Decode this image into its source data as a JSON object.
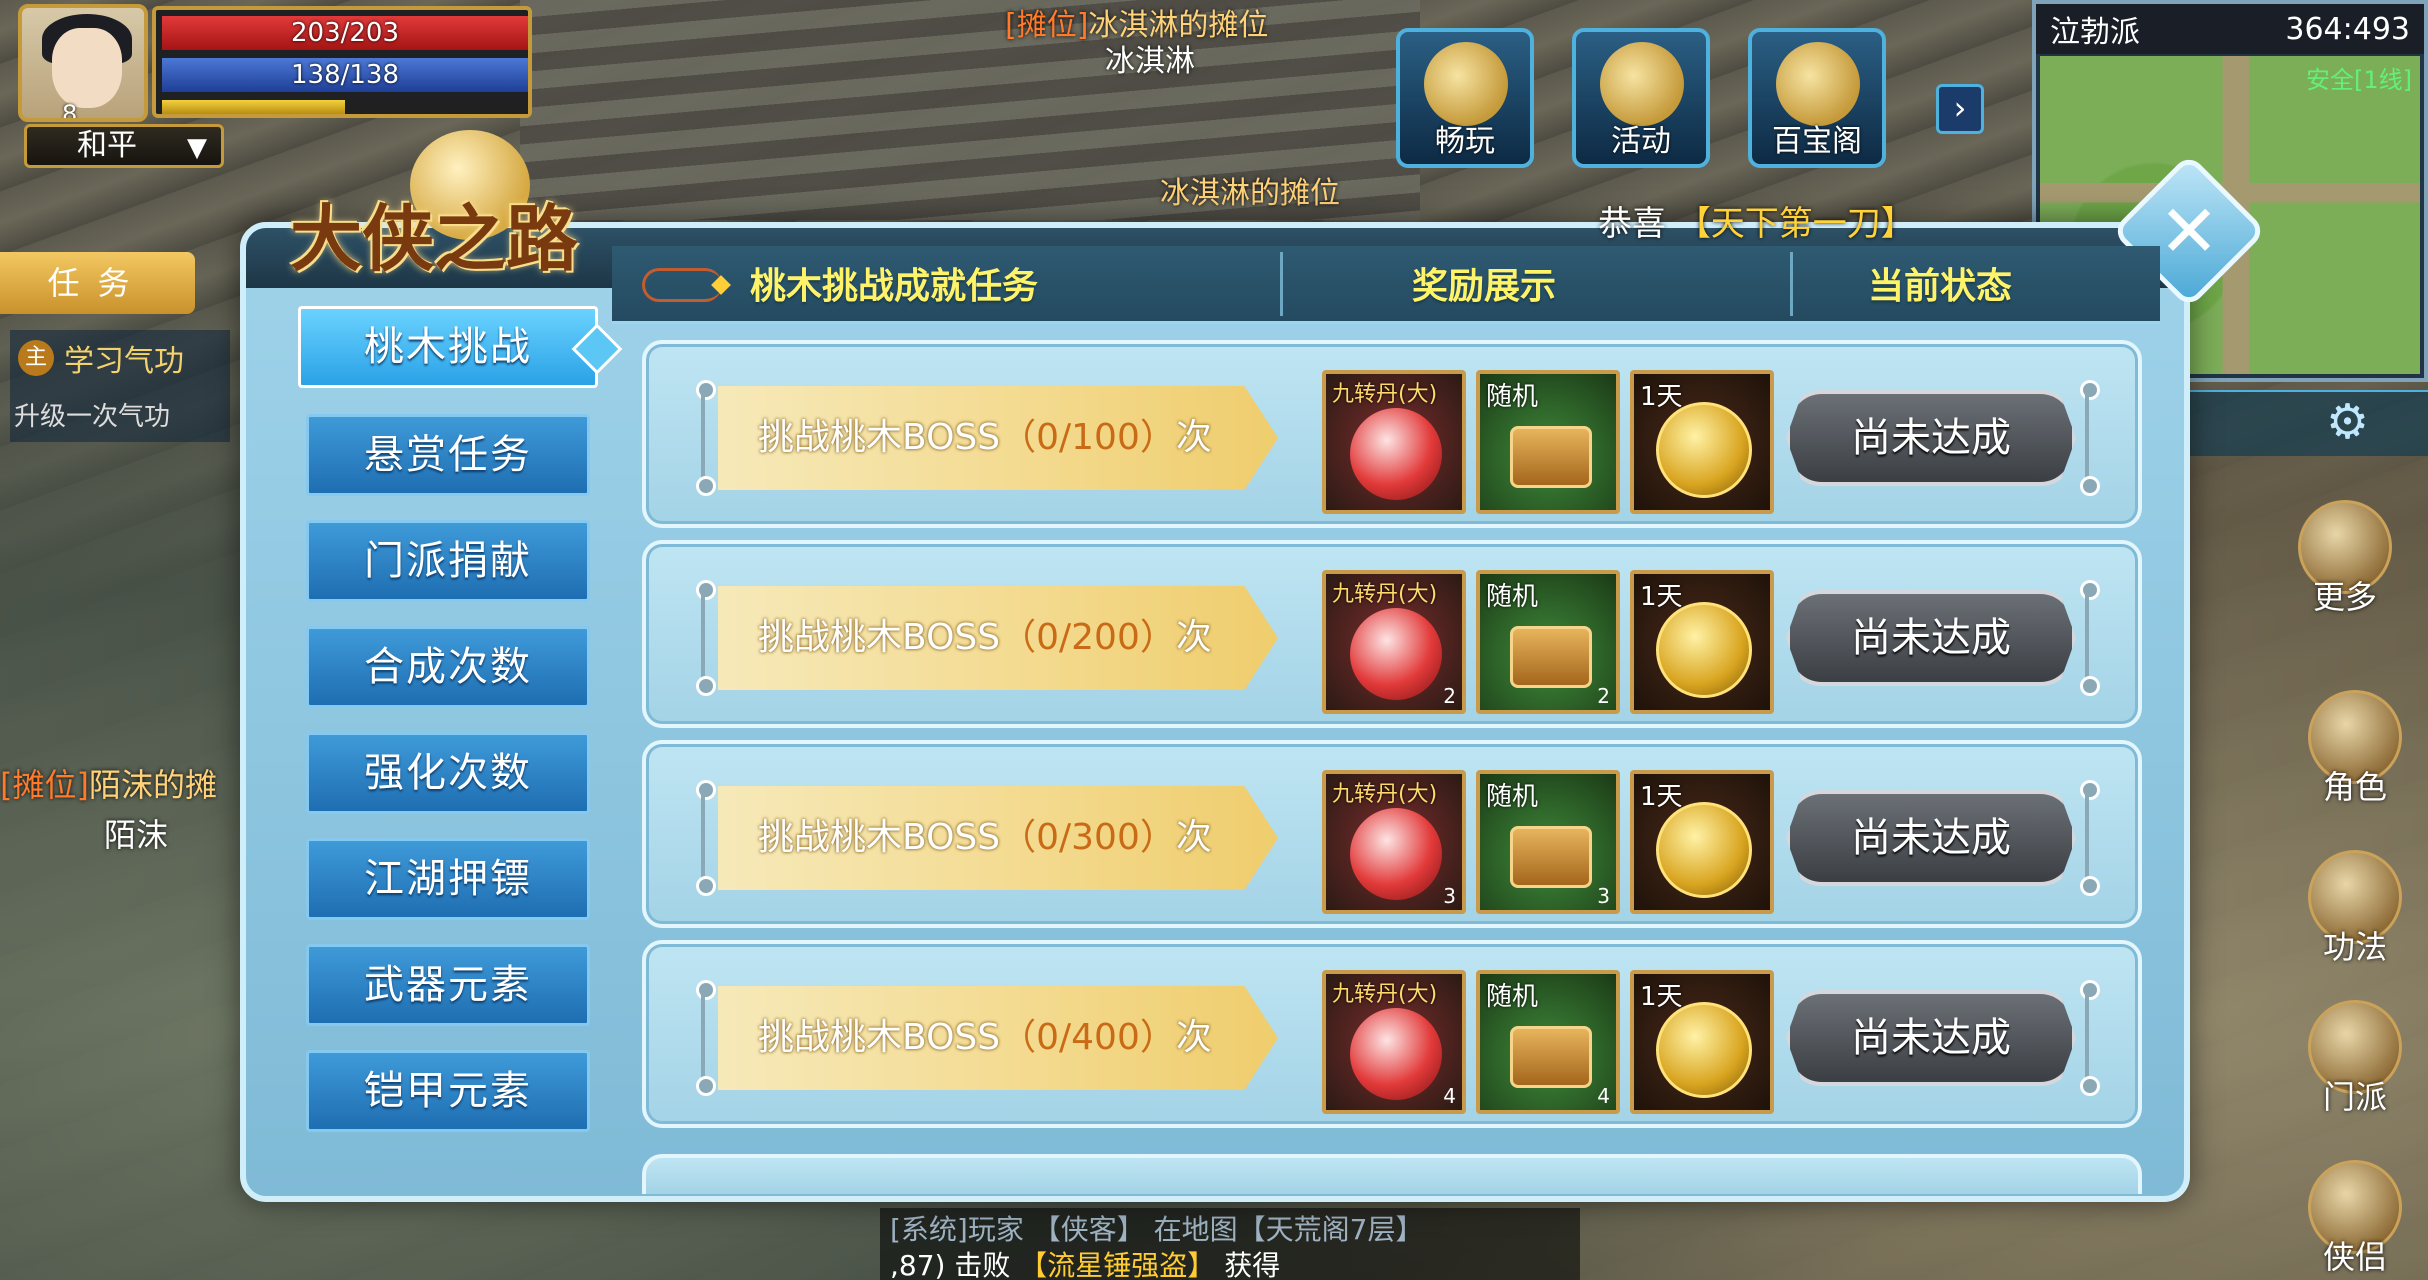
{
  "player": {
    "level": "8",
    "hp": "203/203",
    "mp": "138/138",
    "xp_fraction": 0.5,
    "mode": "和平"
  },
  "world": {
    "stall_top_tag": "[摊位]",
    "stall_top_name": "冰淇淋的摊位",
    "vendor_top": "冰淇淋",
    "stall_hidden": "冰淇淋的摊位",
    "stall_left_tag": "[摊位]",
    "stall_left_name": "陌沫的摊",
    "vendor_left": "陌沫"
  },
  "top_menu": [
    {
      "label": "畅玩",
      "icon": "scroll-icon"
    },
    {
      "label": "活动",
      "icon": "event-icon"
    },
    {
      "label": "百宝阁",
      "icon": "shop-icon"
    }
  ],
  "minimap": {
    "location": "泣勃派",
    "coords": "364:493",
    "safety": "安全[1线]"
  },
  "quest_panel": {
    "tab_label": "任务",
    "quest_badge": "主",
    "quest_title": "学习气功",
    "quest_desc": "升级一次气功"
  },
  "side_icons": [
    {
      "label": "更多"
    },
    {
      "label": "角色"
    },
    {
      "label": "功法"
    },
    {
      "label": "门派"
    },
    {
      "label": "侠侣"
    }
  ],
  "chat": {
    "line1": "[系统]玩家 【侠客】 在地图【天荒阁7层】",
    "line2_pre": ",87) 击败",
    "line2_hl": "【流星锤强盗】",
    "line2_post": "获得"
  },
  "dialog": {
    "title": "大侠之路",
    "congrats_prefix": "恭喜",
    "congrats_title": "【天下第一刀】",
    "close_symbol": "✕",
    "tabs": [
      "桃木挑战",
      "悬赏任务",
      "门派捐献",
      "合成次数",
      "强化次数",
      "江湖押镖",
      "武器元素",
      "铠甲元素"
    ],
    "active_tab": 0,
    "headers": {
      "task": "桃木挑战成就任务",
      "rewards": "奖励展示",
      "status": "当前状态"
    },
    "rows": [
      {
        "task": "挑战桃木BOSS",
        "progress": "（0/100）",
        "unit": "次",
        "pill_label": "九转丹(大)",
        "pill_count": "",
        "box_label": "随机",
        "box_count": "",
        "token_label": "1天",
        "status": "尚未达成"
      },
      {
        "task": "挑战桃木BOSS",
        "progress": "（0/200）",
        "unit": "次",
        "pill_label": "九转丹(大)",
        "pill_count": "2",
        "box_label": "随机",
        "box_count": "2",
        "token_label": "1天",
        "status": "尚未达成"
      },
      {
        "task": "挑战桃木BOSS",
        "progress": "（0/300）",
        "unit": "次",
        "pill_label": "九转丹(大)",
        "pill_count": "3",
        "box_label": "随机",
        "box_count": "3",
        "token_label": "1天",
        "status": "尚未达成"
      },
      {
        "task": "挑战桃木BOSS",
        "progress": "（0/400）",
        "unit": "次",
        "pill_label": "九转丹(大)",
        "pill_count": "4",
        "box_label": "随机",
        "box_count": "4",
        "token_label": "1天",
        "status": "尚未达成"
      }
    ]
  },
  "colors": {
    "header_text": "#fff36a",
    "progress_text": "#c96b16",
    "tab_blue": "#1e6eb2",
    "highlight_gold": "#ffd23a"
  }
}
